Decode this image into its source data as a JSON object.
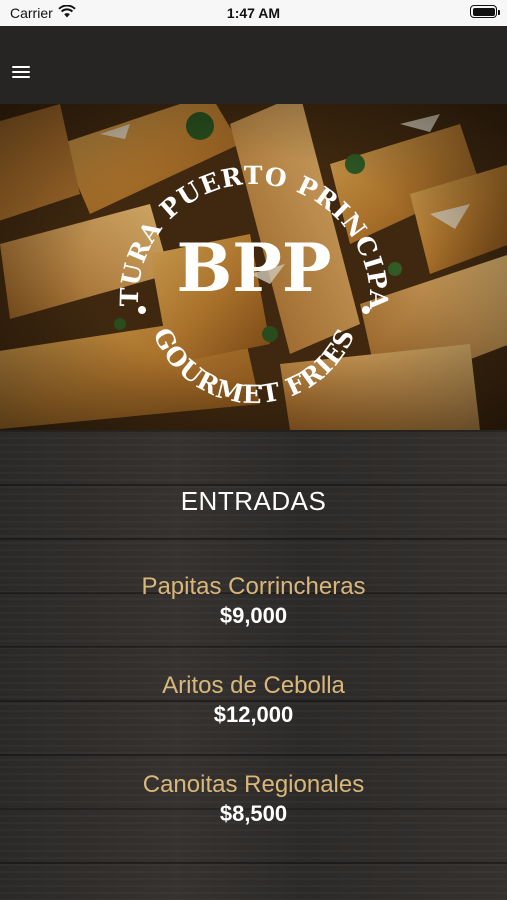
{
  "status_bar": {
    "carrier": "Carrier",
    "time": "1:47 AM",
    "wifi_icon": "wifi-icon",
    "battery_icon": "battery-icon"
  },
  "nav": {
    "menu_icon": "hamburger-menu-icon"
  },
  "logo": {
    "arc_top": "BTURA PUERTO PRINCIPAL",
    "arc_bottom": "GOURMET FRIES",
    "monogram": "BPP"
  },
  "menu": {
    "section_title": "ENTRADAS",
    "items": [
      {
        "name": "Papitas Corrincheras",
        "price": "$9,000"
      },
      {
        "name": "Aritos de Cebolla",
        "price": "$12,000"
      },
      {
        "name": "Canoitas Regionales",
        "price": "$8,500"
      }
    ]
  },
  "colors": {
    "item_name": "#d9b77a",
    "price": "#ffffff",
    "nav_bg": "#272524"
  }
}
